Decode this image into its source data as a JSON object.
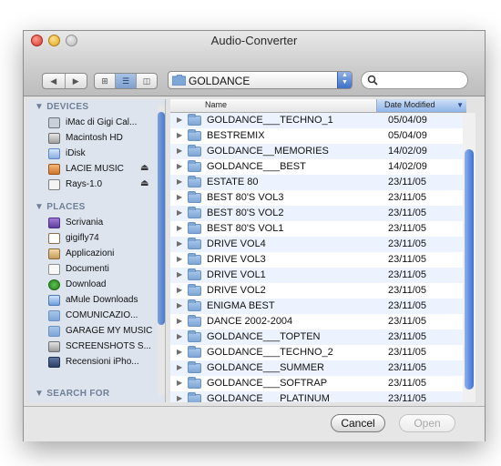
{
  "window": {
    "title": "Audio-Converter"
  },
  "toolbar": {
    "back_icon": "◀",
    "forward_icon": "▶",
    "view_icon_icon": "⊞",
    "view_list_icon": "☰",
    "view_column_icon": "◫",
    "location": "GOLDANCE",
    "search_placeholder": ""
  },
  "sidebar": {
    "devices_header": "DEVICES",
    "places_header": "PLACES",
    "search_for_header": "SEARCH FOR",
    "devices": [
      {
        "label": "iMac di Gigi Cal...",
        "icon": "computer-icon"
      },
      {
        "label": "Macintosh HD",
        "icon": "hard-drive-icon"
      },
      {
        "label": "iDisk",
        "icon": "idisk-icon"
      },
      {
        "label": "LACIE MUSIC",
        "icon": "external-drive-icon",
        "eject": "⏏"
      },
      {
        "label": "Rays-1.0",
        "icon": "disk-image-icon",
        "eject": "⏏"
      }
    ],
    "places": [
      {
        "label": "Scrivania",
        "icon": "desktop-icon"
      },
      {
        "label": "gigifly74",
        "icon": "home-icon"
      },
      {
        "label": "Applicazioni",
        "icon": "applications-icon"
      },
      {
        "label": "Documenti",
        "icon": "documents-icon"
      },
      {
        "label": "Download",
        "icon": "download-icon"
      },
      {
        "label": "aMule Downloads",
        "icon": "amule-icon"
      },
      {
        "label": "COMUNICAZIO...",
        "icon": "folder-icon"
      },
      {
        "label": "GARAGE MY MUSIC",
        "icon": "music-icon"
      },
      {
        "label": "SCREENSHOTS S...",
        "icon": "screenshot-icon"
      },
      {
        "label": "Recensioni iPho...",
        "icon": "app-icon"
      }
    ]
  },
  "list": {
    "col_name": "Name",
    "col_date": "Date Modified",
    "sort_icon": "▼",
    "rows": [
      {
        "name": "GOLDANCE___TECHNO_1",
        "date": "05/04/09"
      },
      {
        "name": "BESTREMIX",
        "date": "05/04/09"
      },
      {
        "name": "GOLDANCE__MEMORIES",
        "date": "14/02/09"
      },
      {
        "name": "GOLDANCE___BEST",
        "date": "14/02/09"
      },
      {
        "name": "ESTATE 80",
        "date": "23/11/05"
      },
      {
        "name": "BEST 80'S VOL3",
        "date": "23/11/05"
      },
      {
        "name": "BEST 80'S VOL2",
        "date": "23/11/05"
      },
      {
        "name": "BEST 80'S VOL1",
        "date": "23/11/05"
      },
      {
        "name": "DRIVE VOL4",
        "date": "23/11/05"
      },
      {
        "name": "DRIVE VOL3",
        "date": "23/11/05"
      },
      {
        "name": "DRIVE VOL1",
        "date": "23/11/05"
      },
      {
        "name": "DRIVE VOL2",
        "date": "23/11/05"
      },
      {
        "name": "ENIGMA BEST",
        "date": "23/11/05"
      },
      {
        "name": "DANCE 2002-2004",
        "date": "23/11/05"
      },
      {
        "name": "GOLDANCE___TOPTEN",
        "date": "23/11/05"
      },
      {
        "name": "GOLDANCE___TECHNO_2",
        "date": "23/11/05"
      },
      {
        "name": "GOLDANCE___SUMMER",
        "date": "23/11/05"
      },
      {
        "name": "GOLDANCE___SOFTRAP",
        "date": "23/11/05"
      },
      {
        "name": "GOLDANCE___PLATINUM",
        "date": "23/11/05"
      }
    ]
  },
  "buttons": {
    "cancel": "Cancel",
    "open": "Open"
  }
}
